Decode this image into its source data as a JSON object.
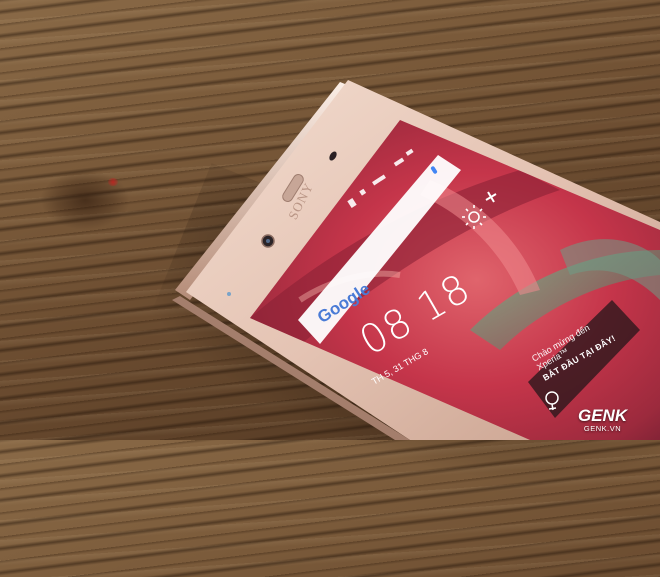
{
  "photo": {
    "subject": "Sony Xperia phone on wooden table",
    "colors": {
      "wood": "#6b4c30",
      "phone_frame": "#e9cdc0",
      "wallpaper_red": "#c83a48"
    }
  },
  "phone": {
    "brand_text": "SONY",
    "search_widget": {
      "logo_text": "Google",
      "mic_icon": "mic-icon"
    },
    "clock": {
      "time": "08 18",
      "date": "TH 5, 31 THG 8"
    },
    "welcome_card": {
      "line1": "Chào mừng đến",
      "line2": "Xperia™",
      "cta": "BẮT ĐẦU TẠI ĐÂY!"
    }
  },
  "watermark": {
    "brand": "GENK",
    "site": "GENK.VN"
  }
}
